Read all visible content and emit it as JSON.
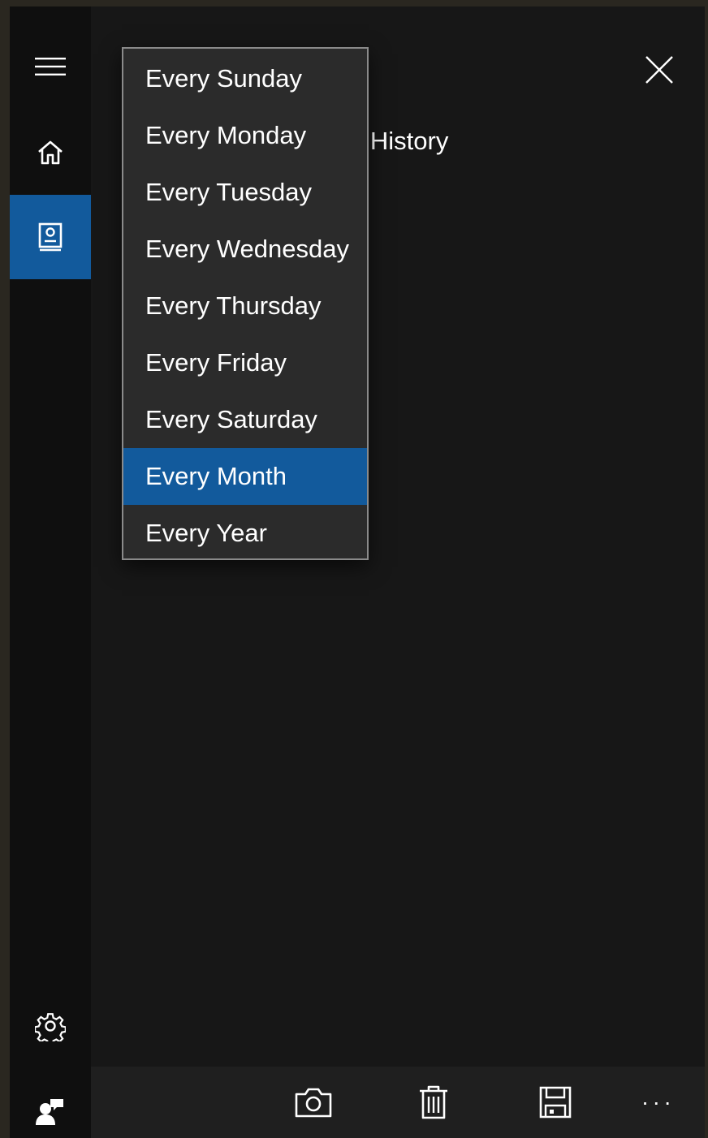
{
  "sidebar": {
    "items": [
      {
        "icon": "hamburger-menu-icon"
      },
      {
        "icon": "home-icon"
      },
      {
        "icon": "notebook-icon",
        "selected": true
      },
      {
        "icon": "gear-icon"
      },
      {
        "icon": "account-feedback-icon"
      }
    ]
  },
  "content": {
    "partial_text": "Move to History"
  },
  "dropdown": {
    "items": [
      "Every Sunday",
      "Every Monday",
      "Every Tuesday",
      "Every Wednesday",
      "Every Thursday",
      "Every Friday",
      "Every Saturday",
      "Every Month",
      "Every Year"
    ],
    "selected": "Every Month"
  },
  "command_bar": {
    "icons": [
      "camera-icon",
      "trash-icon",
      "save-icon",
      "more-icon"
    ],
    "more_label": "..."
  },
  "colors": {
    "accent": "#125a9c",
    "background": "#171717",
    "sidebar": "#0f0f0f",
    "dropdown_bg": "#2b2b2b",
    "dropdown_border": "#8a8a8a"
  }
}
